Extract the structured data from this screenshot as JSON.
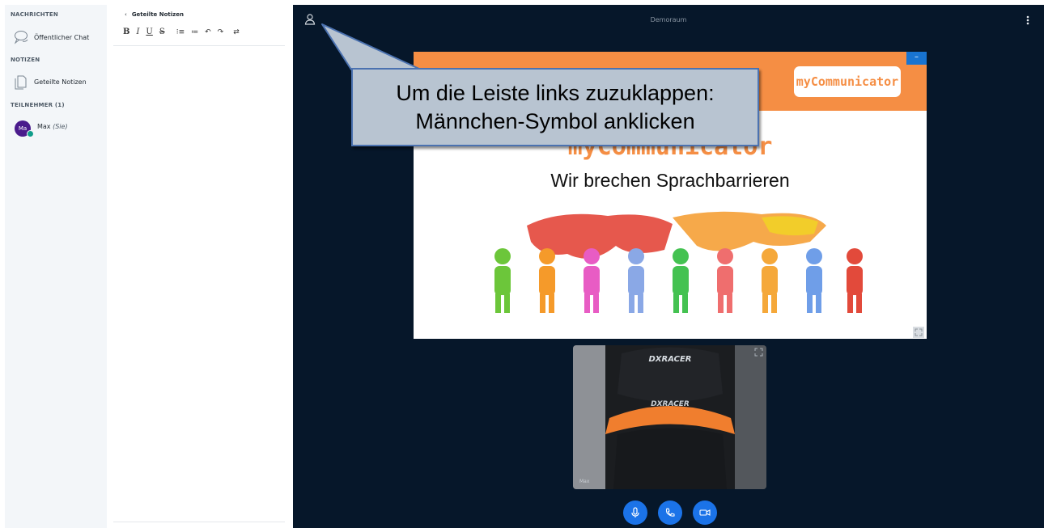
{
  "sidebar": {
    "messages_heading": "NACHRICHTEN",
    "public_chat_label": "Öffentlicher Chat",
    "notes_heading": "NOTIZEN",
    "shared_notes_label": "Geteilte Notizen",
    "participants_heading": "TEILNEHMER (1)",
    "user": {
      "initials": "Ma",
      "name": "Max",
      "self_tag": "(Sie)"
    }
  },
  "notes_panel": {
    "back_label": "Geteilte Notizen",
    "toolbar": {
      "bold": "B",
      "italic": "I",
      "underline": "U",
      "strike": "S",
      "ordered_list": "⁝≡",
      "unordered_list": "≔",
      "undo": "↶",
      "redo": "↷",
      "rtl": "⇄"
    }
  },
  "main": {
    "room_title": "Demoraum",
    "slide": {
      "logo_text": "myCommunicator",
      "brand_text": "myCommunicator",
      "tagline": "Wir brechen Sprachbarrieren",
      "minimize_label": "–"
    },
    "callout": {
      "line1": "Um die Leiste links zuzuklappen:",
      "line2": "Männchen-Symbol anklicken"
    },
    "webcam": {
      "user_label": "Max",
      "chair_brand": "DXRACER"
    },
    "controls": [
      "microphone-icon",
      "phone-icon",
      "video-camera-icon"
    ]
  },
  "colors": {
    "main_bg": "#06172a",
    "sidebar_bg": "#f3f6f9",
    "accent_blue": "#1b73e8",
    "brand_orange": "#f58e44",
    "avatar_purple": "#4a1b8c",
    "presence_teal": "#0f9d8a",
    "callout_fill": "#b8c4d1",
    "callout_border": "#4b72b0"
  }
}
